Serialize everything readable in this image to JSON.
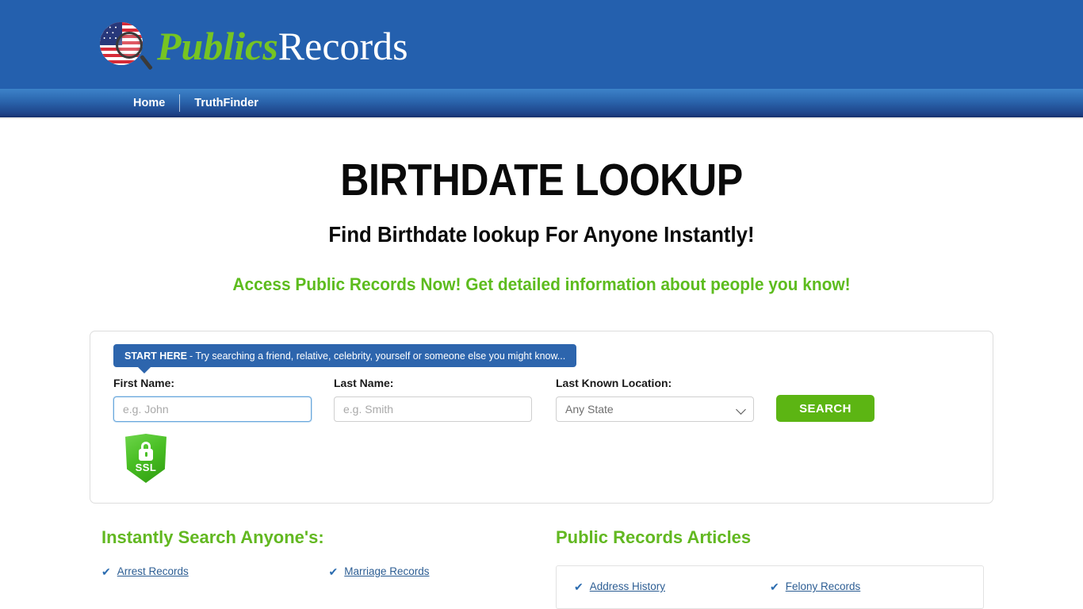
{
  "header": {
    "logo": {
      "icon": "flag-magnifier-icon",
      "text_primary": "Publics",
      "text_secondary": "Records"
    }
  },
  "nav": {
    "items": [
      {
        "label": "Home"
      },
      {
        "label": "TruthFinder"
      }
    ]
  },
  "hero": {
    "title": "BIRTHDATE LOOKUP",
    "subtitle": "Find Birthdate lookup For Anyone Instantly!",
    "tagline": "Access Public Records Now! Get detailed information about people you know!"
  },
  "search": {
    "banner_bold": "START HERE",
    "banner_rest": "- Try searching a friend, relative, celebrity, yourself or someone else you might know...",
    "first_name_label": "First Name:",
    "first_name_value": "",
    "first_name_placeholder": "e.g. John",
    "last_name_label": "Last Name:",
    "last_name_value": "",
    "last_name_placeholder": "e.g. Smith",
    "location_label": "Last Known Location:",
    "location_selected": "Any State",
    "search_button": "SEARCH",
    "ssl_badge_text": "SSL"
  },
  "instantly_search": {
    "title": "Instantly Search Anyone's:",
    "links": [
      {
        "label": "Arrest Records"
      },
      {
        "label": "Marriage Records"
      }
    ]
  },
  "articles": {
    "title": "Public Records Articles",
    "links": [
      {
        "label": "Address History"
      },
      {
        "label": "Felony Records"
      }
    ]
  },
  "colors": {
    "header_blue": "#2460ae",
    "nav_blue_top": "#3d83c9",
    "nav_blue_bottom": "#16306b",
    "brand_green": "#76c422",
    "tagline_green": "#5dbc1e",
    "button_green": "#5cb513",
    "link_blue": "#2c5d93",
    "banner_blue": "#2d65ad"
  }
}
